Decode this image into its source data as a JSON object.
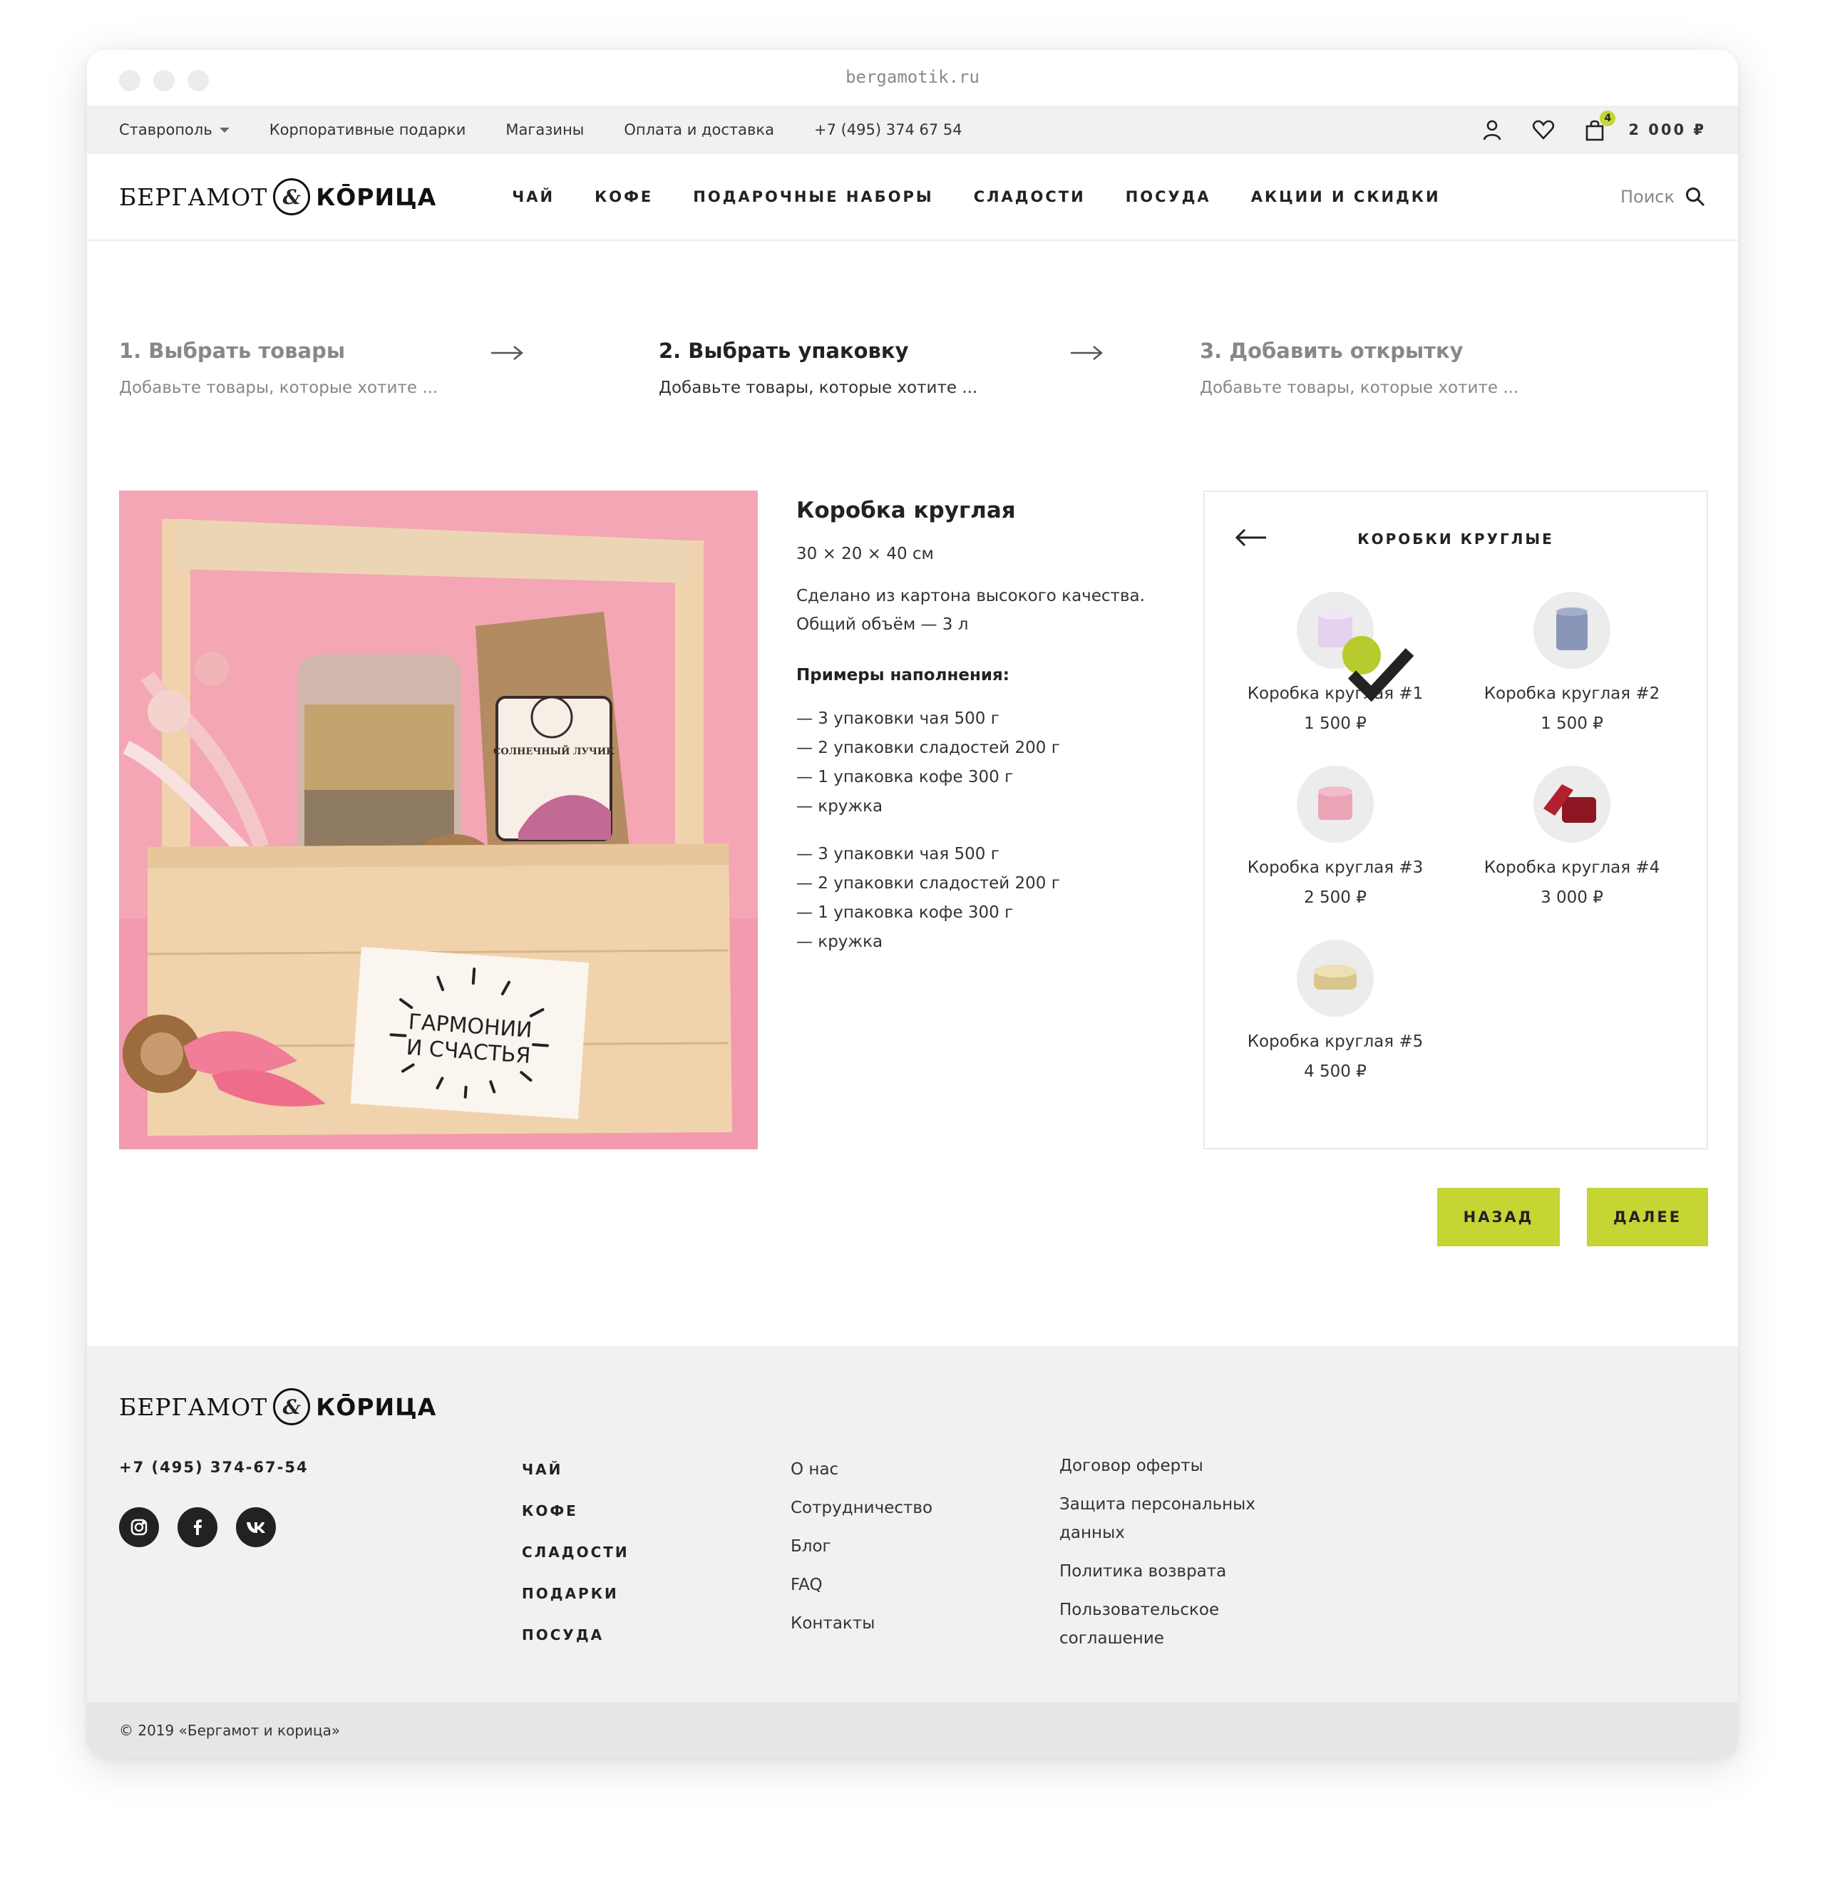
{
  "browser": {
    "url": "bergamotik.ru"
  },
  "topbar": {
    "city": "Ставрополь",
    "links": [
      "Корпоративные подарки",
      "Магазины",
      "Оплата и доставка",
      "+7 (495) 374 67 54"
    ],
    "cart_count": "4",
    "cart_total": "2 000 ₽",
    "icons": [
      "user-icon",
      "heart-icon",
      "bag-icon"
    ]
  },
  "logo": {
    "word1": "БЕРГАМОТ",
    "amp": "&",
    "word2": "КŌРИЦА"
  },
  "nav": [
    "ЧАЙ",
    "КОФЕ",
    "ПОДАРОЧНЫЕ НАБОРЫ",
    "СЛАДОСТИ",
    "ПОСУДА",
    "АКЦИИ И СКИДКИ"
  ],
  "search": {
    "placeholder": "Поиск"
  },
  "steps": [
    {
      "title": "1. Выбрать товары",
      "desc": "Добавьте товары, которые хотите ..."
    },
    {
      "title": "2. Выбрать упаковку",
      "desc": "Добавьте товары, которые хотите ..."
    },
    {
      "title": "3. Добавить открытку",
      "desc": "Добавьте товары, которые хотите ..."
    }
  ],
  "product": {
    "title": "Коробка круглая",
    "dims": "30 × 20 × 40  см",
    "desc_line1": "Сделано из картона высокого качества.",
    "desc_line2": "Общий объём — 3 л",
    "examples_title": "Примеры наполнения:",
    "list1": [
      "— 3 упаковки чая 500 г",
      "— 2 упаковки сладостей 200 г",
      "— 1 упаковка кофе 300 г",
      "— кружка"
    ],
    "list2": [
      "— 3 упаковки чая 500 г",
      "— 2 упаковки сладостей 200 г",
      "— 1 упаковка кофе 300 г",
      "— кружка"
    ],
    "card_text_line1": "ГАРМОНИИ",
    "card_text_line2": "И СЧАСТЬЯ",
    "bag_label": "СОЛНЕЧНЫЙ ЛУЧИК"
  },
  "panel": {
    "title": "КОРОБКИ КРУГЛЫЕ",
    "items": [
      {
        "name": "Коробка круглая #1",
        "price": "1 500 ₽",
        "selected": true,
        "color": "#e4d2ee"
      },
      {
        "name": "Коробка круглая #2",
        "price": "1 500 ₽",
        "selected": false,
        "color": "#8a96b8"
      },
      {
        "name": "Коробка круглая #3",
        "price": "2 500 ₽",
        "selected": false,
        "color": "#eba4b6"
      },
      {
        "name": "Коробка круглая #4",
        "price": "3 000 ₽",
        "selected": false,
        "color": "#8d1622"
      },
      {
        "name": "Коробка круглая #5",
        "price": "4 500 ₽",
        "selected": false,
        "color": "#d9c58e"
      }
    ]
  },
  "buttons": {
    "back": "НАЗАД",
    "next": "ДАЛЕЕ"
  },
  "footer": {
    "phone": "+7 (495) 374-67-54",
    "social": [
      "instagram-icon",
      "facebook-icon",
      "vk-icon"
    ],
    "col1": [
      "ЧАЙ",
      "КОФЕ",
      "СЛАДОСТИ",
      "ПОДАРКИ",
      "ПОСУДА"
    ],
    "col2": [
      "О нас",
      "Сотрудничество",
      "Блог",
      "FAQ",
      "Контакты"
    ],
    "col3": [
      "Договор оферты",
      "Защита персональных данных",
      "Политика возврата",
      "Пользовательское соглашение"
    ],
    "copyright": "© 2019 «Бергамот и корица»"
  },
  "colors": {
    "accent": "#c4d534",
    "check": "#b8cb2e",
    "topbar_bg": "#f1f1f1",
    "photo_bg": "#f4a6b5"
  }
}
